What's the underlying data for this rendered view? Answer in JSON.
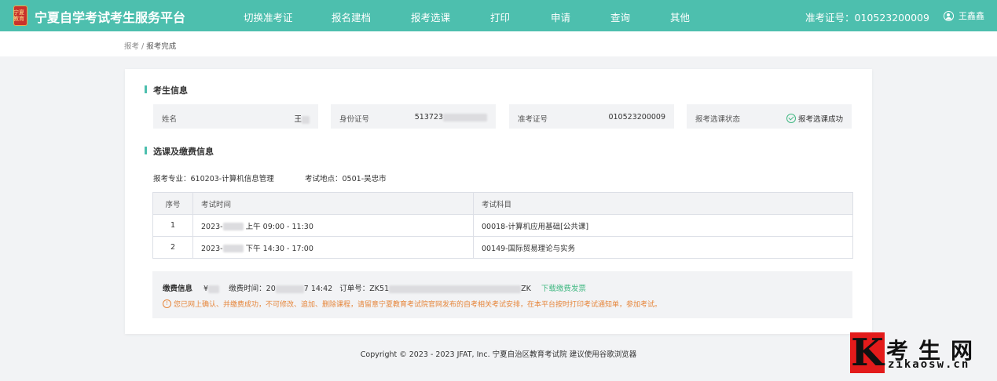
{
  "header": {
    "site_title": "宁夏自学考试考生服务平台",
    "logo_text": "宁夏教育",
    "nav": [
      "切换准考证",
      "报名建档",
      "报考选课",
      "打印",
      "申请",
      "查询",
      "其他"
    ],
    "exam_no_label": "准考证号：",
    "exam_no": "010523200009",
    "user_name": "王鑫鑫",
    "brand_color": "#4dbfae"
  },
  "breadcrumb": {
    "root": "报考",
    "sep": " / ",
    "current": "报考完成"
  },
  "candidate": {
    "section_title": "考生信息",
    "name_label": "姓名",
    "name_value": "王",
    "id_label": "身份证号",
    "id_value": "513723",
    "exam_no_label": "准考证号",
    "exam_no_value": "010523200009",
    "status_label": "报考选课状态",
    "status_value": "报考选课成功"
  },
  "course": {
    "section_title": "选课及缴费信息",
    "major_label": "报考专业：",
    "major_value": "610203-计算机信息管理",
    "site_label": "考试地点：",
    "site_value": "0501-吴忠市",
    "columns": [
      "序号",
      "考试时间",
      "考试科目"
    ],
    "rows": [
      {
        "no": "1",
        "date": "2023-",
        "time": "上午 09:00 - 11:30",
        "subject": "00018-计算机应用基础[公共课]"
      },
      {
        "no": "2",
        "date": "2023-",
        "time": "下午 14:30 - 17:00",
        "subject": "00149-国际贸易理论与实务"
      }
    ]
  },
  "payment": {
    "title": "缴费信息",
    "amount_prefix": "¥",
    "time_label": "缴费时间：",
    "time_value_prefix": "20",
    "time_value_suffix": "7 14:42",
    "order_label": "订单号：",
    "order_prefix": "ZK51",
    "order_suffix": "ZK",
    "invoice_link": "下载缴费发票",
    "tip": "您已网上确认、并缴费成功，不可修改、追加、删除课程，请留意宁夏教育考试院官网发布的自考相关考试安排，在本平台按时打印考试通知单，参加考试。"
  },
  "footer": {
    "copyright": "Copyright © 2023 - 2023 JFAT, Inc. 宁夏自治区教育考试院 建议使用谷歌浏览器"
  },
  "watermark": {
    "letter": "K",
    "cn": "考生网",
    "en": "zikaosw.cn"
  }
}
